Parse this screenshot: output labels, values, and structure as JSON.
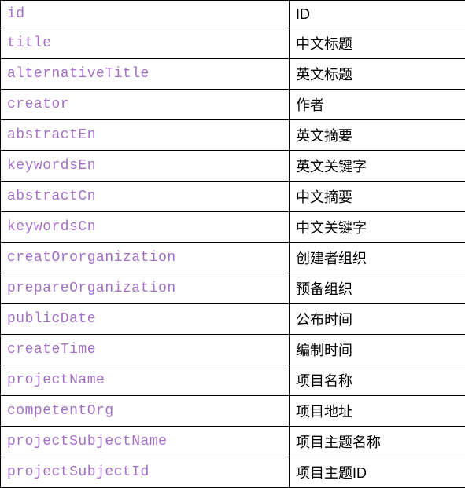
{
  "rows": [
    {
      "key": "id",
      "val": "ID"
    },
    {
      "key": "title",
      "val": "中文标题"
    },
    {
      "key": "alternativeTitle",
      "val": "英文标题"
    },
    {
      "key": "creator",
      "val": "作者"
    },
    {
      "key": "abstractEn",
      "val": "英文摘要"
    },
    {
      "key": "keywordsEn",
      "val": "英文关键字"
    },
    {
      "key": "abstractCn",
      "val": "中文摘要"
    },
    {
      "key": "keywordsCn",
      "val": "中文关键字"
    },
    {
      "key": "creatOrorganization",
      "val": "创建者组织"
    },
    {
      "key": "prepareOrganization",
      "val": "预备组织"
    },
    {
      "key": "publicDate",
      "val": "公布时间"
    },
    {
      "key": "createTime",
      "val": "编制时间"
    },
    {
      "key": "projectName",
      "val": "项目名称"
    },
    {
      "key": "competentOrg",
      "val": "项目地址"
    },
    {
      "key": "projectSubjectName",
      "val": "项目主题名称"
    },
    {
      "key": "projectSubjectId",
      "val": "项目主题ID"
    }
  ]
}
